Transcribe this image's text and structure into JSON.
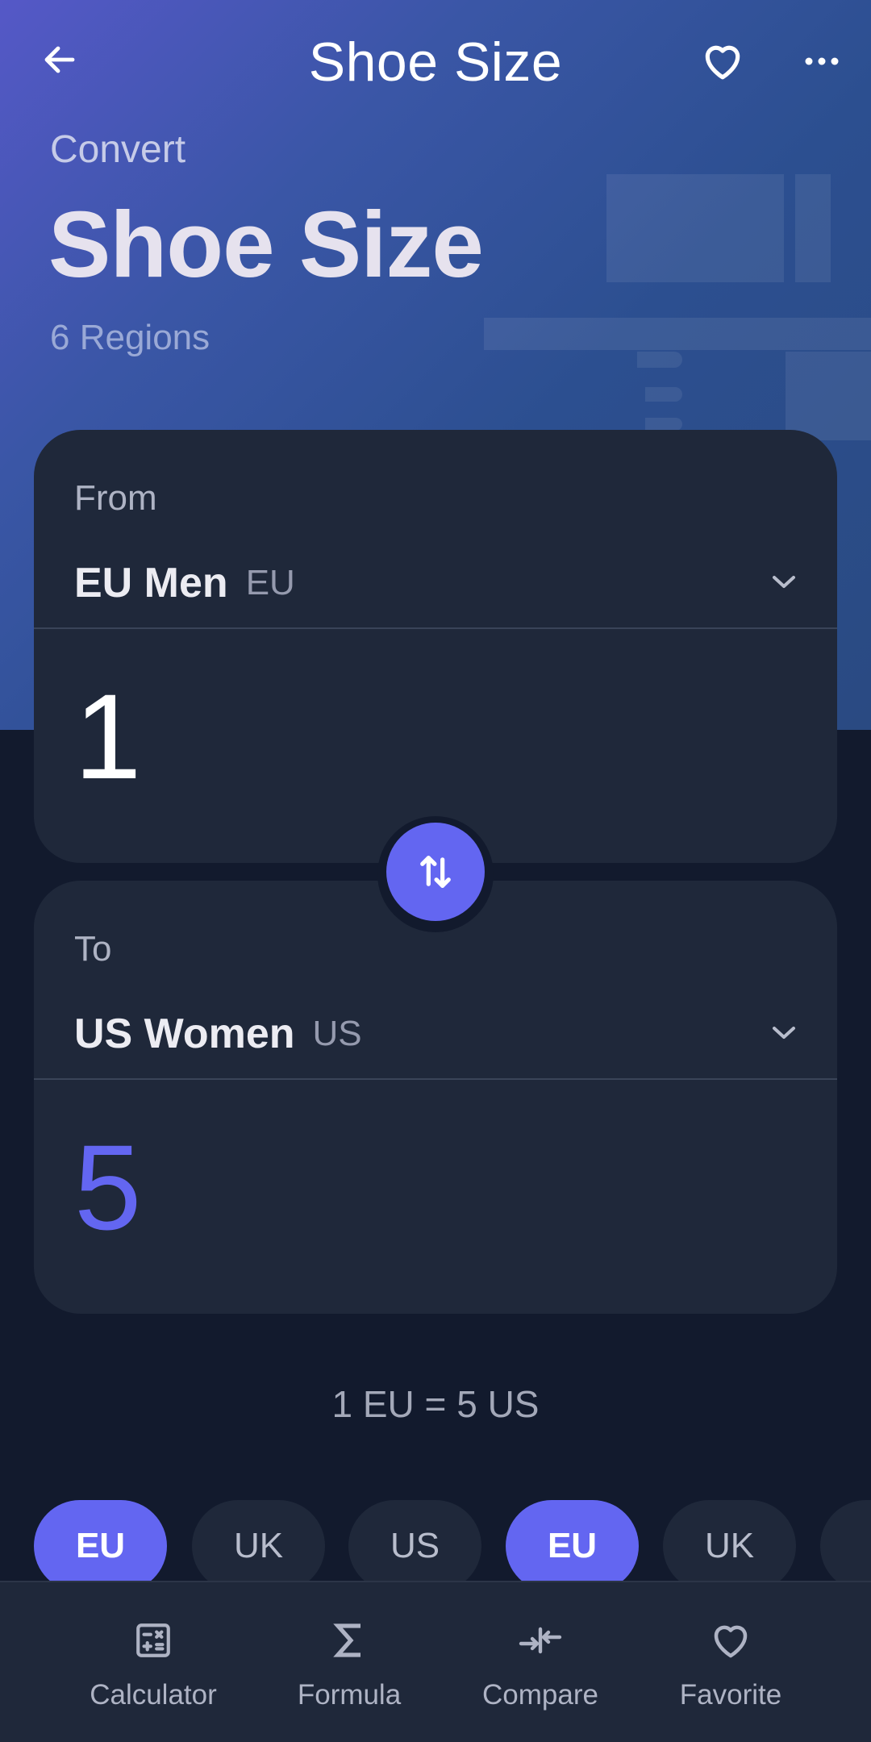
{
  "header": {
    "title": "Shoe Size",
    "back_icon": "arrow-left-icon",
    "favorite_icon": "heart-outline-icon",
    "more_icon": "more-horizontal-icon"
  },
  "hero": {
    "eyebrow": "Convert",
    "title": "Shoe Size",
    "subtitle": "6 Regions"
  },
  "from": {
    "label": "From",
    "unit_name": "EU Men",
    "unit_abbr": "EU",
    "value": "1"
  },
  "to": {
    "label": "To",
    "unit_name": "US Women",
    "unit_abbr": "US",
    "value": "5"
  },
  "summary": "1 EU = 5 US",
  "chips": [
    {
      "label": "EU",
      "active": true
    },
    {
      "label": "UK",
      "active": false
    },
    {
      "label": "US",
      "active": false
    },
    {
      "label": "EU",
      "active": true
    },
    {
      "label": "UK",
      "active": false
    }
  ],
  "nav": [
    {
      "label": "Calculator",
      "icon": "calculator-icon"
    },
    {
      "label": "Formula",
      "icon": "sigma-icon"
    },
    {
      "label": "Compare",
      "icon": "compare-arrows-icon"
    },
    {
      "label": "Favorite",
      "icon": "heart-outline-icon"
    }
  ],
  "colors": {
    "accent": "#6366f1",
    "background": "#121a2d",
    "card": "#1f283a"
  }
}
